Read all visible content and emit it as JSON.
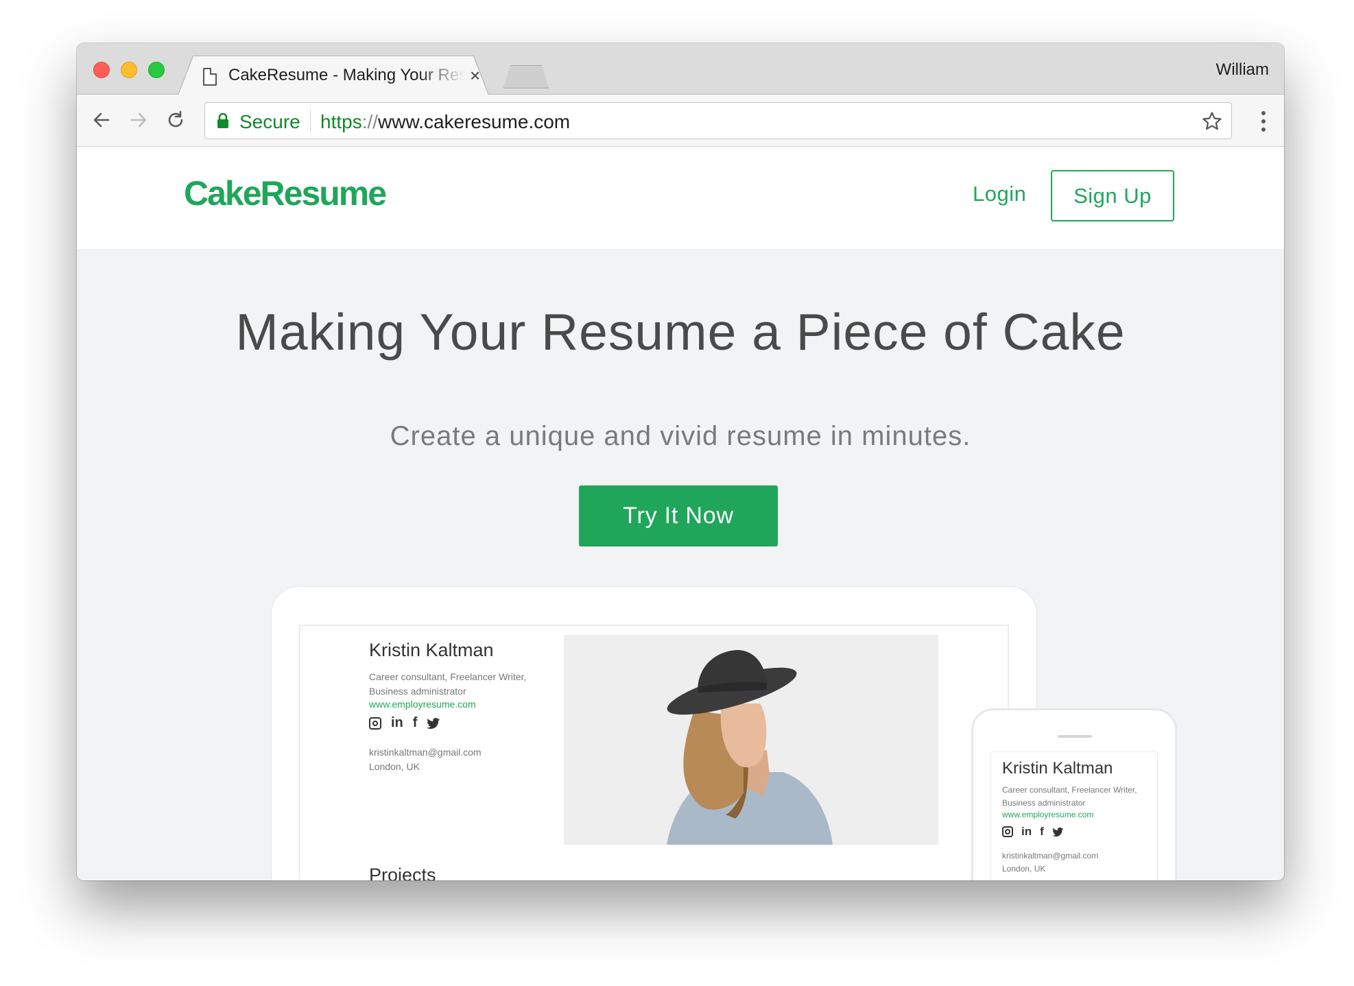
{
  "browser": {
    "tab_title": "CakeResume - Making Your Resume a Piece of Cake",
    "tab_close": "×",
    "profile_name": "William",
    "secure_label": "Secure",
    "url_scheme": "https",
    "url_separator": "://",
    "url_host": "www.cakeresume.com",
    "icons": [
      "back-arrow-icon",
      "forward-arrow-icon",
      "reload-icon",
      "lock-icon",
      "star-icon",
      "more-vert-icon",
      "document-icon",
      "close-icon"
    ]
  },
  "site": {
    "logo": "CakeResume",
    "login": "Login",
    "signup": "Sign Up",
    "brand_color": "#1fa65a"
  },
  "hero": {
    "title": "Making Your Resume a Piece of Cake",
    "subtitle": "Create a unique and vivid resume in minutes.",
    "cta": "Try It Now"
  },
  "preview": {
    "name": "Kristin Kaltman",
    "role_line1": "Career consultant, Freelancer Writer,",
    "role_line2": "Business administrator",
    "website": "www.employresume.com",
    "social": {
      "linkedin": "in",
      "facebook": "f",
      "twitter": "🐦"
    },
    "email": "kristinkaltman@gmail.com",
    "location": "London, UK",
    "projects_heading": "Projects"
  }
}
